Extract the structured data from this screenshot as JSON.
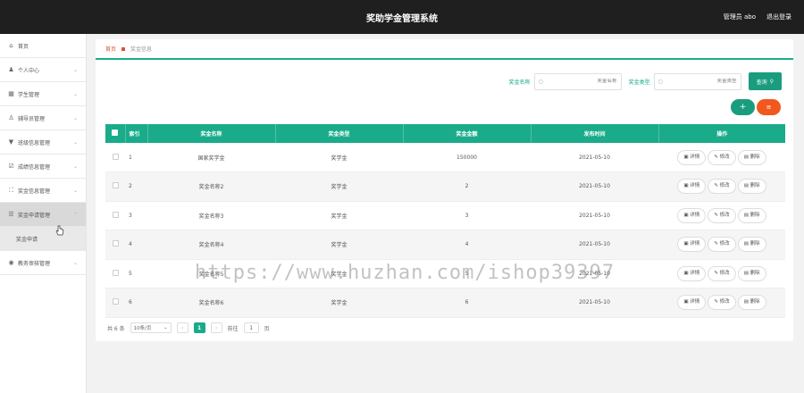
{
  "header": {
    "title": "奖助学金管理系统",
    "user_label": "管理员 abo",
    "logout_label": "退出登录"
  },
  "sidebar": {
    "items": [
      {
        "label": "首页",
        "icon": "home-icon",
        "has_chevron": false
      },
      {
        "label": "个人中心",
        "icon": "user-icon",
        "has_chevron": true
      },
      {
        "label": "学生管理",
        "icon": "student-icon",
        "has_chevron": true
      },
      {
        "label": "辅导员管理",
        "icon": "counselor-icon",
        "has_chevron": true
      },
      {
        "label": "班级信息管理",
        "icon": "class-icon",
        "has_chevron": true
      },
      {
        "label": "成绩信息管理",
        "icon": "grade-icon",
        "has_chevron": true
      },
      {
        "label": "奖金信息管理",
        "icon": "bonus-icon",
        "has_chevron": true
      },
      {
        "label": "奖金申请管理",
        "icon": "apply-icon",
        "has_chevron": true
      },
      {
        "label": "教务审核管理",
        "icon": "audit-icon",
        "has_chevron": true
      }
    ],
    "sub_item": "奖金申请"
  },
  "breadcrumb": {
    "home": "首页",
    "current": "奖金信息"
  },
  "search": {
    "name_label": "奖金名称",
    "name_placeholder": "奖金名称",
    "type_label": "奖金类型",
    "type_placeholder": "奖金类型",
    "query_button": "查询"
  },
  "buttons": {
    "add": "+",
    "delete": "≡"
  },
  "table": {
    "headers": [
      "索引",
      "奖金名称",
      "奖金类型",
      "奖金金额",
      "发布时间",
      "操作"
    ],
    "rows": [
      {
        "index": "1",
        "name": "国家奖学金",
        "type": "奖学金",
        "amount": "150000",
        "date": "2021-05-10"
      },
      {
        "index": "2",
        "name": "奖金名称2",
        "type": "奖学金",
        "amount": "2",
        "date": "2021-05-10"
      },
      {
        "index": "3",
        "name": "奖金名称3",
        "type": "奖学金",
        "amount": "3",
        "date": "2021-05-10"
      },
      {
        "index": "4",
        "name": "奖金名称4",
        "type": "奖学金",
        "amount": "4",
        "date": "2021-05-10"
      },
      {
        "index": "5",
        "name": "奖金名称5",
        "type": "奖学金",
        "amount": "5",
        "date": "2021-05-10"
      },
      {
        "index": "6",
        "name": "奖金名称6",
        "type": "奖学金",
        "amount": "6",
        "date": "2021-05-10"
      }
    ],
    "actions": {
      "detail": "详情",
      "edit": "修改",
      "delete": "删除"
    }
  },
  "pager": {
    "total": "共 6 条",
    "page_size": "10条/页",
    "current_page": "1",
    "goto_label": "前往",
    "goto_value": "1",
    "page_unit": "页"
  },
  "watermark": "https://www.huzhan.com/ishop39397",
  "colors": {
    "accent": "#1aab8a",
    "danger": "#f2571e",
    "header_bg": "#1f1f1f"
  }
}
